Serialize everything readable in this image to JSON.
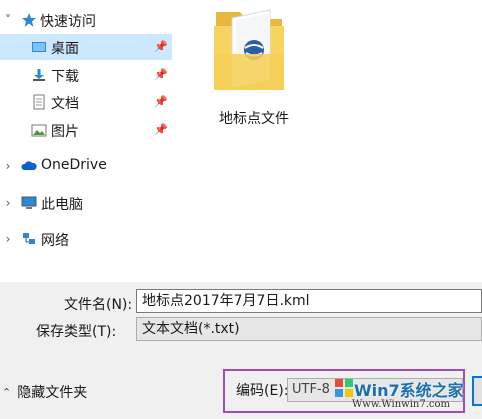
{
  "nav": {
    "quick_access": "快速访问",
    "desktop": "桌面",
    "downloads": "下载",
    "documents": "文档",
    "pictures": "图片",
    "onedrive": "OneDrive",
    "this_pc": "此电脑",
    "network": "网络"
  },
  "content": {
    "files": [
      {
        "name": "地标点文件",
        "icon": "folder-icon"
      }
    ]
  },
  "form": {
    "filename_label": "文件名(N):",
    "filename_value": "地标点2017年7月7日.kml",
    "filetype_label": "保存类型(T):",
    "filetype_value": "文本文档(*.txt)",
    "hide_folders": "隐藏文件夹",
    "encoding_label": "编码(E):",
    "encoding_value": "UTF-8"
  },
  "watermark": {
    "title": "Win7系统之家",
    "url": "Www.Winwin7.com"
  },
  "colors": {
    "selected_bg": "#cce8ff",
    "panel_bg": "#f0f0f0",
    "highlight_border": "#9b4fb0",
    "folder_yellow": "#f7d35f"
  }
}
